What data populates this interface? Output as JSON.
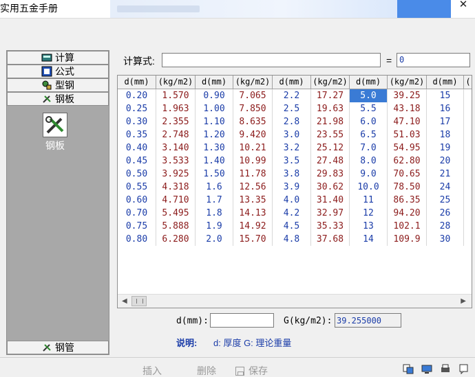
{
  "window": {
    "title": "实用五金手册",
    "close_glyph": "✕"
  },
  "sidebar": {
    "items": [
      {
        "label": "计算",
        "icon": "calculator-icon"
      },
      {
        "label": "公式",
        "icon": "formula-icon"
      },
      {
        "label": "型钢",
        "icon": "profile-steel-icon"
      },
      {
        "label": "钢板",
        "icon": "steel-plate-tools-icon"
      }
    ],
    "active_label": "钢板",
    "bottom_item": {
      "label": "钢管",
      "icon": "steel-pipe-tools-icon"
    }
  },
  "calc": {
    "label": "计算式:",
    "expression": "",
    "equals": "=",
    "result": "0"
  },
  "table": {
    "headers": [
      "d(mm)",
      "(kg/m2)",
      "d(mm)",
      "(kg/m2)",
      "d(mm)",
      "(kg/m2)",
      "d(mm)",
      "(kg/m2)",
      "d(mm)",
      "("
    ],
    "rows": [
      [
        "0.20",
        "1.570",
        "0.90",
        "7.065",
        "2.2",
        "17.27",
        "5.0",
        "39.25",
        "15",
        ""
      ],
      [
        "0.25",
        "1.963",
        "1.00",
        "7.850",
        "2.5",
        "19.63",
        "5.5",
        "43.18",
        "16",
        ""
      ],
      [
        "0.30",
        "2.355",
        "1.10",
        "8.635",
        "2.8",
        "21.98",
        "6.0",
        "47.10",
        "17",
        ""
      ],
      [
        "0.35",
        "2.748",
        "1.20",
        "9.420",
        "3.0",
        "23.55",
        "6.5",
        "51.03",
        "18",
        ""
      ],
      [
        "0.40",
        "3.140",
        "1.30",
        "10.21",
        "3.2",
        "25.12",
        "7.0",
        "54.95",
        "19",
        ""
      ],
      [
        "0.45",
        "3.533",
        "1.40",
        "10.99",
        "3.5",
        "27.48",
        "8.0",
        "62.80",
        "20",
        ""
      ],
      [
        "0.50",
        "3.925",
        "1.50",
        "11.78",
        "3.8",
        "29.83",
        "9.0",
        "70.65",
        "21",
        ""
      ],
      [
        "0.55",
        "4.318",
        "1.6",
        "12.56",
        "3.9",
        "30.62",
        "10.0",
        "78.50",
        "24",
        ""
      ],
      [
        "0.60",
        "4.710",
        "1.7",
        "13.35",
        "4.0",
        "31.40",
        "11",
        "86.35",
        "25",
        ""
      ],
      [
        "0.70",
        "5.495",
        "1.8",
        "14.13",
        "4.2",
        "32.97",
        "12",
        "94.20",
        "26",
        ""
      ],
      [
        "0.75",
        "5.888",
        "1.9",
        "14.92",
        "4.5",
        "35.33",
        "13",
        "102.1",
        "28",
        ""
      ],
      [
        "0.80",
        "6.280",
        "2.0",
        "15.70",
        "4.8",
        "37.68",
        "14",
        "109.9",
        "30",
        ""
      ]
    ],
    "selected_cell": {
      "row": 0,
      "col": 6
    }
  },
  "inputs": {
    "d_label": "d(mm):",
    "d_value": "",
    "g_label": "G(kg/m2):",
    "g_value": "39.255000"
  },
  "note": {
    "label": "说明:",
    "text": "d: 厚度  G: 理论重量"
  },
  "toolbar": {
    "insert": "插入",
    "delete": "删除",
    "save": "保存"
  },
  "colors": {
    "selection": "#3a7bd5",
    "thickness_text": "#1a3ca8",
    "weight_text": "#8b1a1a",
    "sidebar_bg": "#a8a8a8"
  }
}
